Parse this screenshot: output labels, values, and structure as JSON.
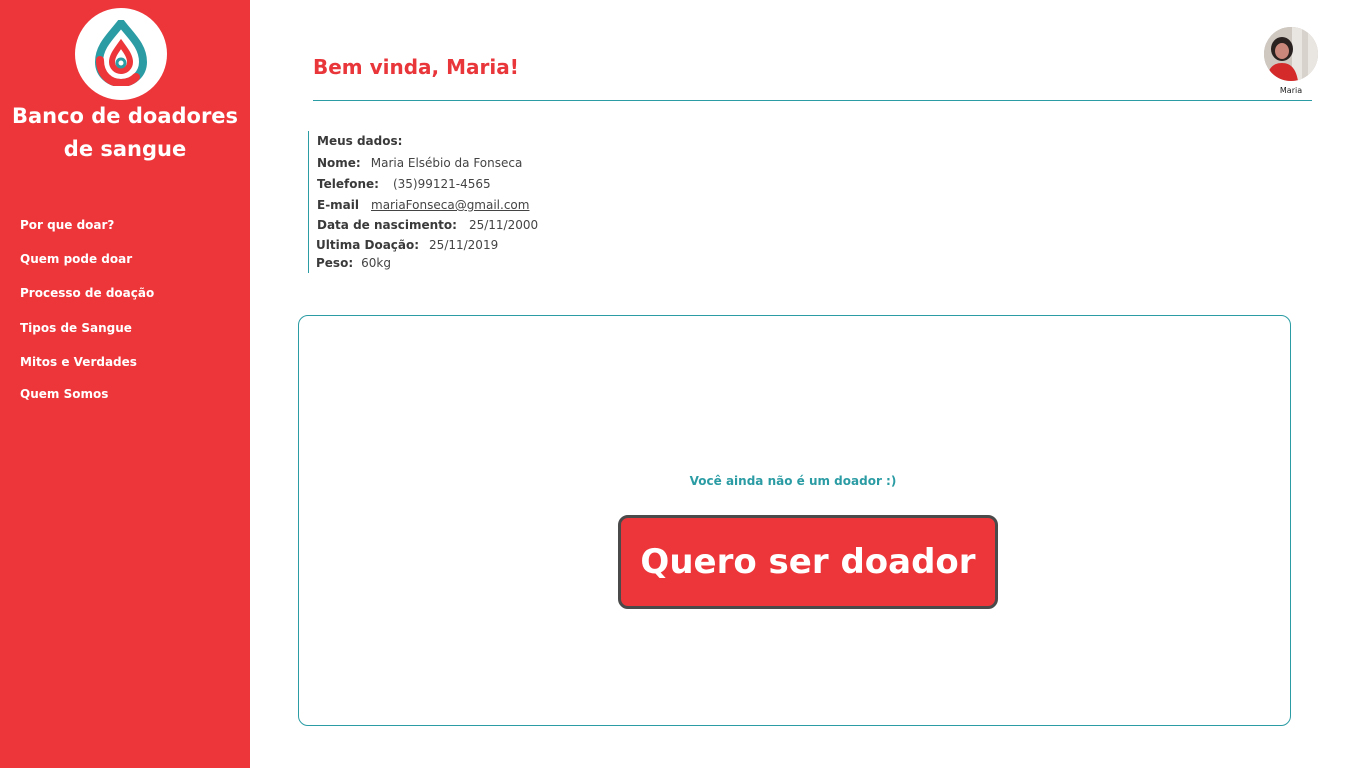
{
  "brand": {
    "line1": "Banco de doadores",
    "line2": "de sangue",
    "logo_icon": "blood-drop-logo-icon",
    "colors": {
      "red": "#ed363a",
      "teal": "#2b9ca4"
    }
  },
  "nav": {
    "items": [
      {
        "label": "Por que doar?"
      },
      {
        "label": "Quem pode doar"
      },
      {
        "label": "Processo de doação"
      },
      {
        "label": "Tipos de Sangue"
      },
      {
        "label": "Mitos e Verdades"
      },
      {
        "label": "Quem Somos"
      }
    ]
  },
  "header": {
    "welcome": "Bem vinda, Maria!",
    "avatar_name": "Maria"
  },
  "profile": {
    "title": "Meus dados:",
    "fields": [
      {
        "label": "Nome:",
        "value": "Maria Elsébio da Fonseca"
      },
      {
        "label": "Telefone:",
        "value": "(35)99121-4565"
      },
      {
        "label": "E-mail",
        "value": "mariaFonseca@gmail.com"
      },
      {
        "label": "Data de nascimento:",
        "value": "25/11/2000"
      },
      {
        "label": "Ultima Doação:",
        "value": "25/11/2019"
      },
      {
        "label": "Peso:",
        "value": "60kg"
      }
    ]
  },
  "donor_card": {
    "status": "Você ainda não é um doador :)",
    "cta_label": "Quero ser doador"
  }
}
